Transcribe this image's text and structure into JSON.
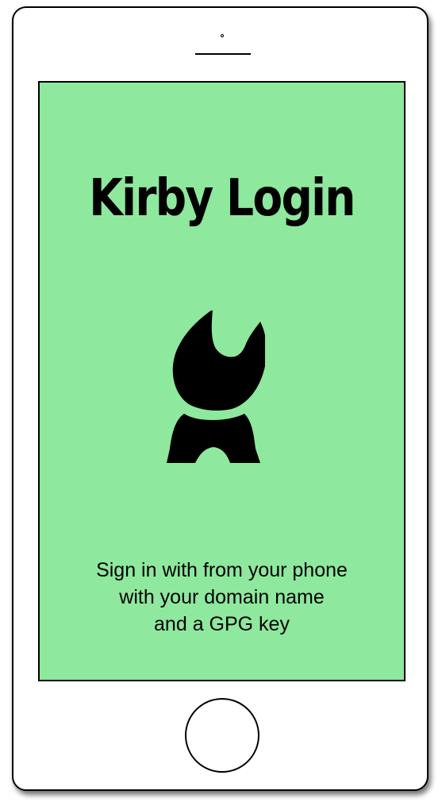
{
  "app": {
    "title": "Kirby Login",
    "subtitle": "Sign in with from your phone\nwith your domain name\nand a GPG key"
  },
  "colors": {
    "screen_background": "#8ee89d",
    "foreground": "#000000",
    "device_frame": "#ffffff"
  },
  "icons": {
    "logo": "kirby-cat-logo-icon",
    "home_button": "home-button-icon"
  }
}
